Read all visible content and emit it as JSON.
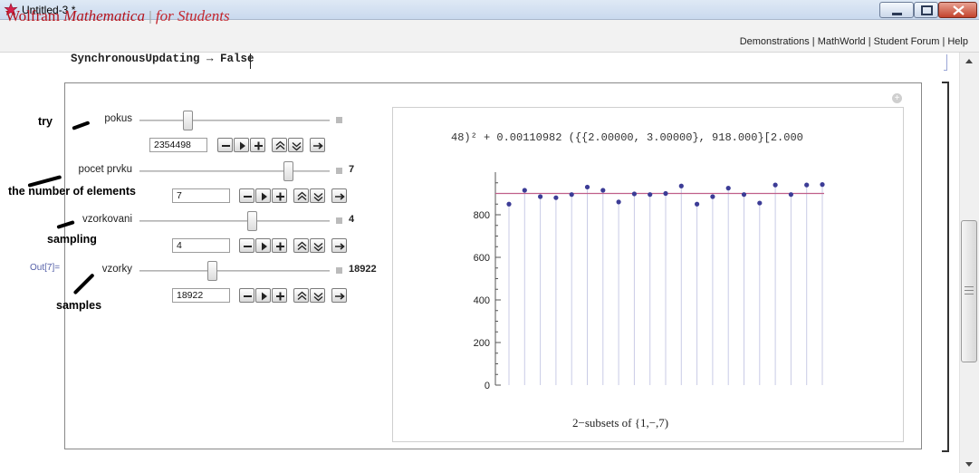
{
  "window": {
    "title": "Untitled-3 *",
    "accent": "#b5121b"
  },
  "banner": {
    "brand_wolfram": "Wolfram ",
    "brand_mathematica": "Mathematica",
    "brand_sep": "|",
    "brand_students": "for Students",
    "links": "Demonstrations | MathWorld | Student Forum | Help"
  },
  "notebook": {
    "code_line": "SynchronousUpdating → False",
    "out_label": "Out[7]="
  },
  "controls": [
    {
      "label": "pokus",
      "box": "2354498",
      "value": "",
      "annotation": "try",
      "slider": 0.25
    },
    {
      "label": "pocet prvku",
      "box": "7",
      "value": "7",
      "annotation": "the number of elements",
      "slider": 0.78
    },
    {
      "label": "vzorkovani",
      "box": "4",
      "value": "4",
      "annotation": "sampling",
      "slider": 0.59
    },
    {
      "label": "vzorky",
      "box": "18922",
      "value": "18922",
      "annotation": "samples",
      "slider": 0.38
    }
  ],
  "plot": {
    "formula": "48)² + 0.00110982 ({{2.00000, 3.00000}, 918.000}[2.000",
    "caption": "2−subsets of {1,−,7)"
  },
  "chart_data": {
    "type": "scatter",
    "title": "",
    "xlabel": "2−subsets of {1,−,7)",
    "ylabel": "",
    "ylim": [
      0,
      1000
    ],
    "yticks": [
      0,
      200,
      400,
      600,
      800
    ],
    "ytick_labels": [
      "0",
      "200",
      "400",
      "600",
      "800"
    ],
    "reference_line": 900,
    "point_color": "#3c3c96",
    "line_color": "#c0608a",
    "stem_color": "#c9cbe6",
    "x": [
      1,
      2,
      3,
      4,
      5,
      6,
      7,
      8,
      9,
      10,
      11,
      12,
      13,
      14,
      15,
      16,
      17,
      18,
      19,
      20,
      21
    ],
    "y": [
      850,
      915,
      885,
      880,
      895,
      930,
      915,
      860,
      898,
      895,
      900,
      935,
      850,
      885,
      925,
      895,
      855,
      940,
      895,
      940,
      942
    ]
  }
}
